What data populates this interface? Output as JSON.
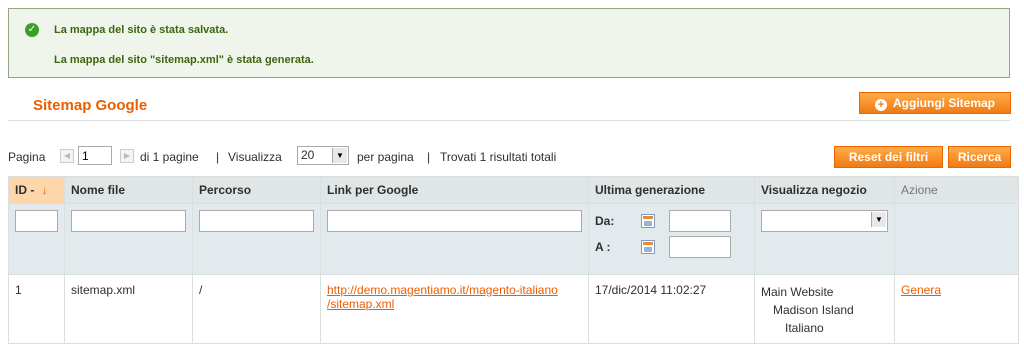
{
  "messages": {
    "success1": "La mappa del sito è stata salvata.",
    "success2": "La mappa del sito \"sitemap.xml\" è stata generata."
  },
  "header": {
    "title": "Sitemap Google",
    "add_button": "Aggiungi Sitemap"
  },
  "pager": {
    "page_label": "Pagina",
    "page_value": "1",
    "of_pages": "di 1 pagine",
    "sep1": "|",
    "view_label": "Visualizza",
    "limit": "20",
    "per_page": "per pagina",
    "sep2": "|",
    "found": "Trovati 1 risultati totali"
  },
  "actions": {
    "reset": "Reset dei filtri",
    "search": "Ricerca"
  },
  "columns": [
    "ID",
    "Nome file",
    "Percorso",
    "Link per Google",
    "Ultima generazione",
    "Visualizza negozio",
    "Azione"
  ],
  "filters": {
    "date_from": "Da:",
    "date_to": "A :"
  },
  "rows": [
    {
      "id": "1",
      "filename": "sitemap.xml",
      "path": "/",
      "link_line1": "http://demo.magentiamo.it/magento-italiano",
      "link_line2": "/sitemap.xml",
      "last_generated": "17/dic/2014 11:02:27",
      "store_line1": "Main Website",
      "store_line2": "Madison Island",
      "store_line3": "Italiano",
      "action": "Genera"
    }
  ]
}
